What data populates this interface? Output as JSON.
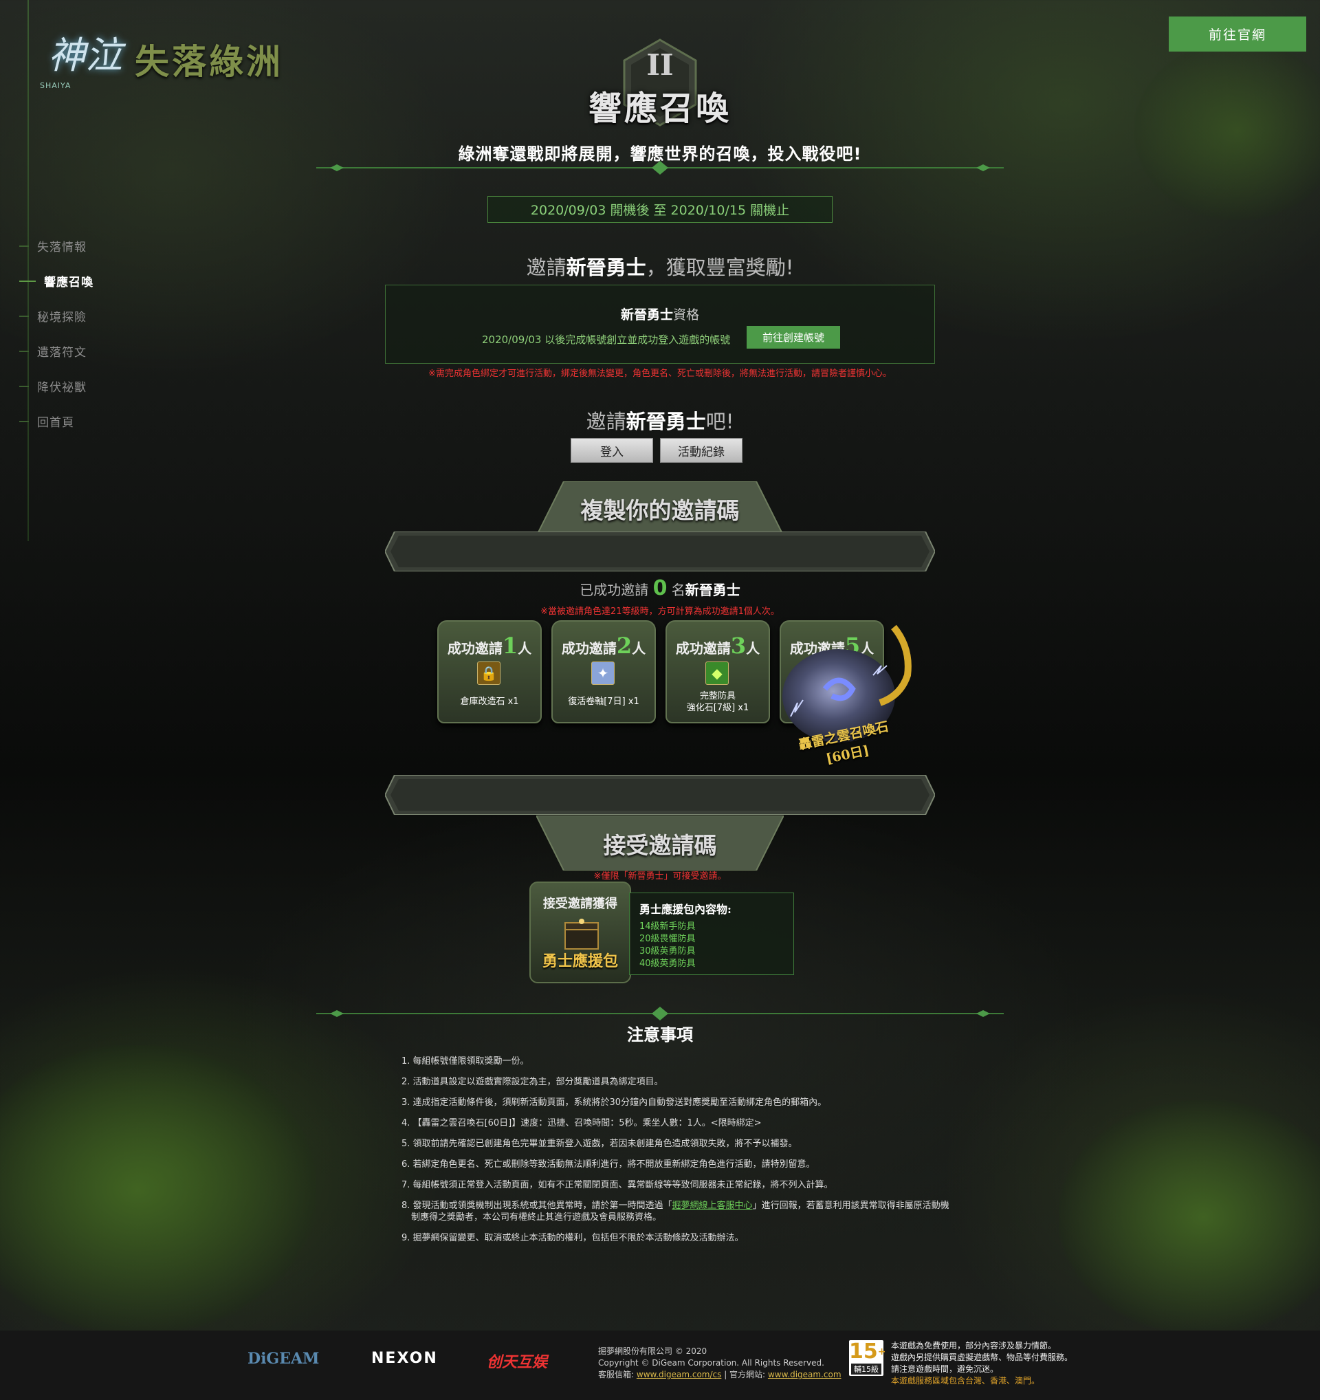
{
  "logo": {
    "mark": "神泣",
    "sub": "SHAIYA",
    "title": "失落綠洲"
  },
  "nav": [
    {
      "label": "失落情報",
      "active": false
    },
    {
      "label": "響應召喚",
      "active": true
    },
    {
      "label": "秘境探險",
      "active": false
    },
    {
      "label": "遺落符文",
      "active": false
    },
    {
      "label": "降伏祕獸",
      "active": false
    },
    {
      "label": "回首頁",
      "active": false
    }
  ],
  "top_button": "前往官網",
  "header": {
    "roman": "II",
    "title": "響應召喚",
    "subtitle": "綠洲奪還戰即將展開，響應世界的召喚，投入戰役吧!",
    "date_range": "2020/09/03 開機後 至 2020/10/15 關機止"
  },
  "invite": {
    "heading_pre": "邀請",
    "heading_bold": "新晉勇士",
    "heading_post": "，獲取豐富獎勵!",
    "qual_bold": "新晉勇士",
    "qual_post": "資格",
    "qual_desc": "2020/09/03 以後完成帳號創立並成功登入遊戲的帳號",
    "create_button": "前往創建帳號",
    "warning": "※需完成角色綁定才可進行活動，綁定後無法變更，角色更名、死亡或刪除後，將無法進行活動，請冒險者謹慎小心。",
    "cta_pre": "邀請",
    "cta_bold": "新晉勇士",
    "cta_post": "吧!",
    "login_button": "登入",
    "record_button": "活動紀錄"
  },
  "copy_code": {
    "banner": "複製你的邀請碼",
    "success_pre": "已成功邀請",
    "success_count": "0",
    "success_mid": "名",
    "success_bold": "新晉勇士",
    "note": "※當被邀請角色達21等級時，方可計算為成功邀請1個人次。"
  },
  "rewards": [
    {
      "pre": "成功邀請",
      "n": "1",
      "post": "人",
      "name": "倉庫改造石 x1",
      "icon": "🔒"
    },
    {
      "pre": "成功邀請",
      "n": "2",
      "post": "人",
      "name": "復活卷軸[7日] x1",
      "icon": "✦"
    },
    {
      "pre": "成功邀請",
      "n": "3",
      "post": "人",
      "name1": "完整防具",
      "name2": "強化石[7級] x1",
      "icon": "◆"
    },
    {
      "pre": "成功邀請",
      "n": "5",
      "post": "人",
      "name1": "轟雷之雲召喚石",
      "name2": "[60日]"
    }
  ],
  "accept": {
    "banner": "接受邀請碼",
    "note": "※僅限「新晉勇士」可接受邀請。",
    "pack_head": "接受邀請獲得",
    "pack_name": "勇士應援包",
    "contents_title": "勇士應援包內容物:",
    "contents": [
      "14級新手防具",
      "20級畏懼防具",
      "30級英勇防具",
      "40級英勇防具"
    ]
  },
  "notice": {
    "title": "注意事項",
    "items": [
      "1. 每組帳號僅限領取獎勵一份。",
      "2. 活動道具設定以遊戲實際設定為主，部分獎勵道具為綁定項目。",
      "3. 達成指定活動條件後，須刷新活動頁面，系統將於30分鐘內自動發送對應獎勵至活動綁定角色的郵箱內。",
      "4. 【轟雷之雲召喚石[60日]】速度：迅捷、召喚時間：5秒。乘坐人數：1人。<限時綁定>",
      "5. 領取前請先確認已創建角色完畢並重新登入遊戲，若因未創建角色造成領取失敗，將不予以補發。",
      "6. 若綁定角色更名、死亡或刪除等致活動無法順利進行，將不開放重新綁定角色進行活動，請特別留意。",
      "7. 每組帳號須正常登入活動頁面，如有不正常關閉頁面、異常斷線等等致伺服器未正常紀錄，將不列入計算。",
      "9. 掘夢網保留變更、取消或終止本活動的權利，包括但不限於本活動條款及活動辦法。"
    ],
    "item8_pre": "8. 發現活動或領獎機制出現系統或其他異常時，請於第一時間透過「",
    "item8_link": "掘夢網線上客服中心",
    "item8_post": "」進行回報，若蓄意利用該異常取得非屬原活動機制應得之獎勵者，本公司有權終止其進行遊戲及會員服務資格。"
  },
  "footer": {
    "digeam": "DiGEAM",
    "nexon": "NEXON",
    "ctmx": "创天互娱",
    "copy1": "掘夢網股份有限公司 © 2020",
    "copy2": "Copyright © DiGeam Corporation. All Rights Reserved.",
    "cs_label": "客服信箱:",
    "cs_link": "www.digeam.com/cs",
    "site_label": "| 官方網站:",
    "site_link": "www.digeam.com",
    "rating_num": "15",
    "rating_plus": "+",
    "rating_label": "輔15級",
    "rate1": "本遊戲為免費使用，部分內容涉及暴力情節。",
    "rate2": "遊戲內另提供購買虛擬遊戲幣、物品等付費服務。",
    "rate3": "請注意遊戲時間，避免沉迷。",
    "rate4": "本遊戲服務區域包含台灣、香港、澳門。"
  },
  "colors": {
    "accent_green": "#4c9a48",
    "highlight_green": "#6ed15a",
    "warning_red": "#e33333",
    "gold": "#e9c44a"
  }
}
